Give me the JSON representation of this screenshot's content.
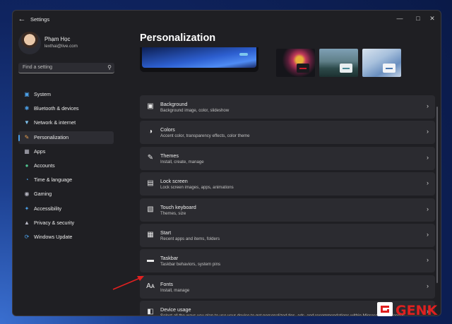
{
  "window": {
    "title": "Settings",
    "controls": [
      "minimize-icon",
      "maximize-icon",
      "close-icon"
    ]
  },
  "user": {
    "name": "Phạm Học",
    "email": "lexthai@live.com"
  },
  "search": {
    "placeholder": "Find a setting"
  },
  "sidebar": {
    "items": [
      {
        "label": "System",
        "icon": "display-icon",
        "color": "#4ca0e8",
        "active": false
      },
      {
        "label": "Bluetooth & devices",
        "icon": "bluetooth-icon",
        "color": "#4ca0e8",
        "active": false
      },
      {
        "label": "Network & internet",
        "icon": "wifi-icon",
        "color": "#7fc3ee",
        "active": false
      },
      {
        "label": "Personalization",
        "icon": "brush-icon",
        "color": "#e8a052",
        "active": true
      },
      {
        "label": "Apps",
        "icon": "apps-icon",
        "color": "#b8b8c4",
        "active": false
      },
      {
        "label": "Accounts",
        "icon": "person-icon",
        "color": "#4fc28e",
        "active": false
      },
      {
        "label": "Time & language",
        "icon": "globe-clock-icon",
        "color": "#4ca0e8",
        "active": false
      },
      {
        "label": "Gaming",
        "icon": "controller-icon",
        "color": "#b8b8c4",
        "active": false
      },
      {
        "label": "Accessibility",
        "icon": "accessibility-icon",
        "color": "#4ca0e8",
        "active": false
      },
      {
        "label": "Privacy & security",
        "icon": "shield-icon",
        "color": "#b8b8c4",
        "active": false
      },
      {
        "label": "Windows Update",
        "icon": "update-icon",
        "color": "#4ca0e8",
        "active": false
      }
    ]
  },
  "main": {
    "title": "Personalization",
    "cards": [
      {
        "title": "Background",
        "subtitle": "Background image, color, slideshow",
        "icon": "image-icon"
      },
      {
        "title": "Colors",
        "subtitle": "Accent color, transparency effects, color theme",
        "icon": "palette-icon"
      },
      {
        "title": "Themes",
        "subtitle": "Install, create, manage",
        "icon": "pen-icon"
      },
      {
        "title": "Lock screen",
        "subtitle": "Lock screen images, apps, animations",
        "icon": "lock-screen-icon"
      },
      {
        "title": "Touch keyboard",
        "subtitle": "Themes, size",
        "icon": "keyboard-icon"
      },
      {
        "title": "Start",
        "subtitle": "Recent apps and items, folders",
        "icon": "start-icon"
      },
      {
        "title": "Taskbar",
        "subtitle": "Taskbar behaviors, system pins",
        "icon": "taskbar-icon"
      },
      {
        "title": "Fonts",
        "subtitle": "Install, manage",
        "icon": "fonts-icon"
      },
      {
        "title": "Device usage",
        "subtitle": "Select all the ways you plan to use your device to get personalized tips, ads, and recommendations within Microsoft experiences.",
        "icon": "device-usage-icon"
      }
    ]
  },
  "watermark": {
    "text": "GENK"
  },
  "colors": {
    "accent": "#4ca0e8",
    "arrow": "#e02020",
    "logo": "#e02020"
  }
}
